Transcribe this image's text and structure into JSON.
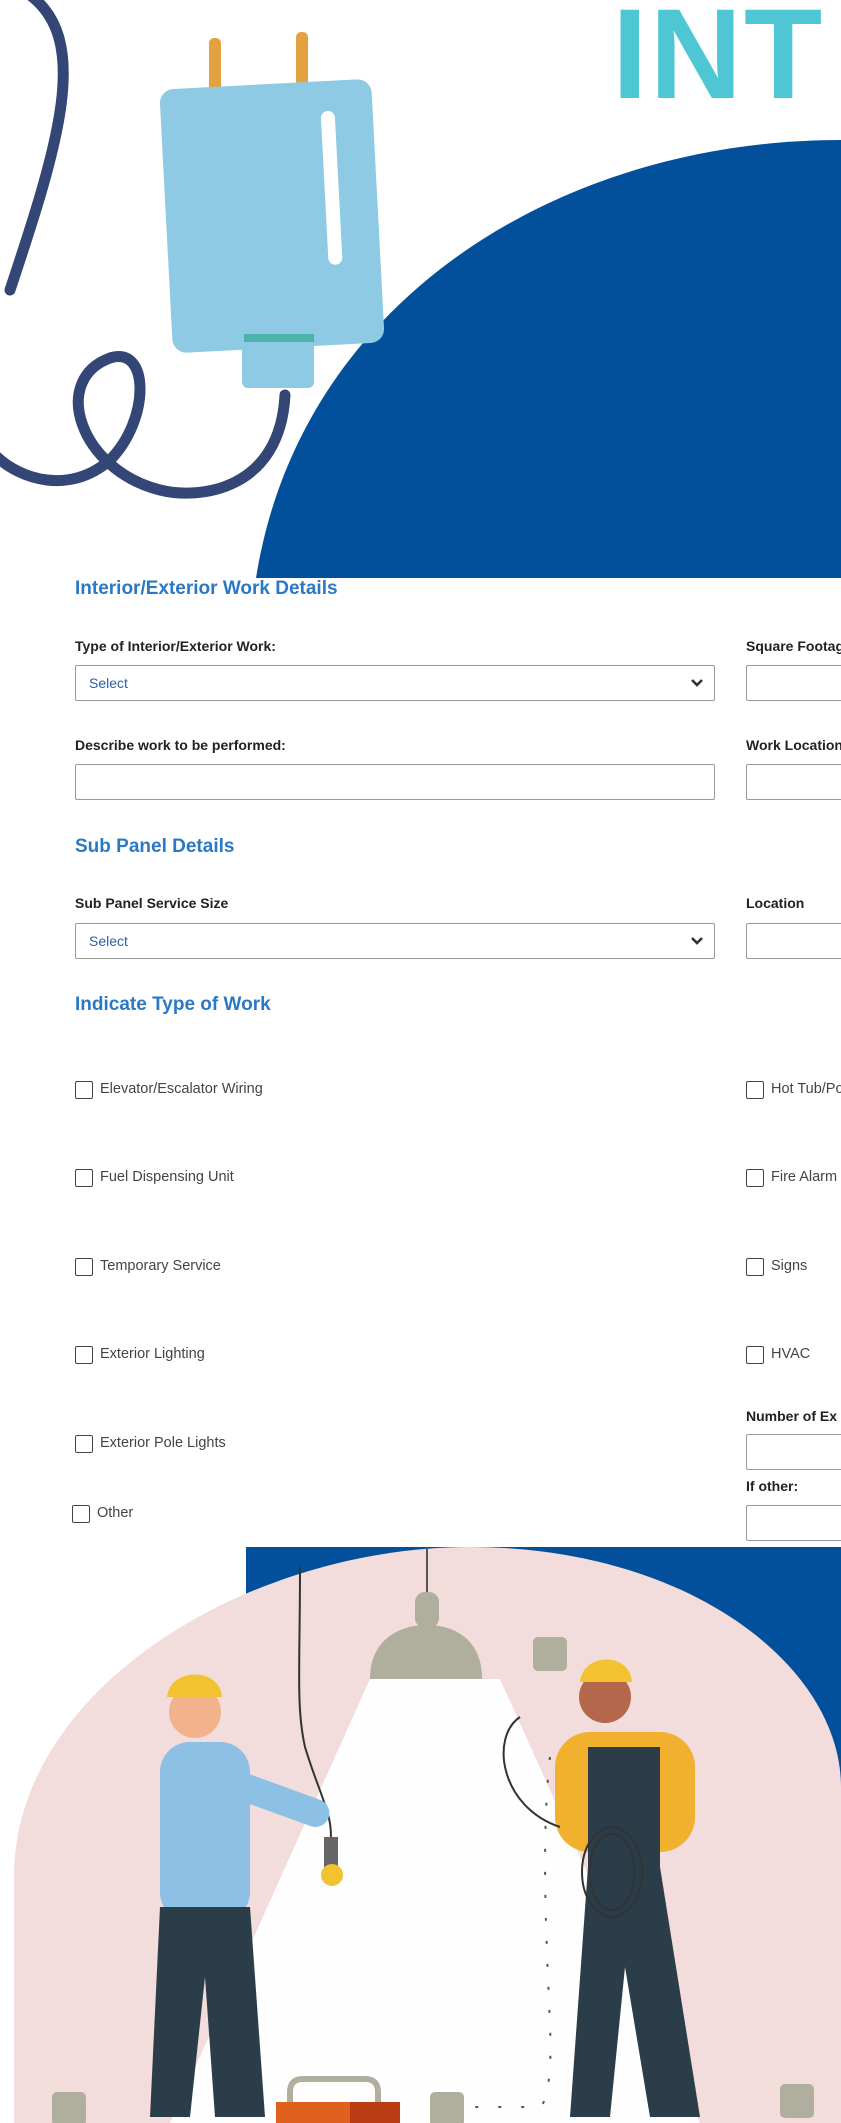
{
  "header": {
    "title": "INT"
  },
  "sections": {
    "work_details": {
      "heading": "Interior/Exterior Work Details",
      "type_label": "Type of Interior/Exterior Work:",
      "type_value": "Select",
      "square_label": "Square Footag",
      "describe_label": "Describe work to be performed:",
      "location_label": "Work Location"
    },
    "sub_panel": {
      "heading": "Sub Panel Details",
      "size_label": "Sub Panel Service Size",
      "size_value": "Select",
      "location_label": "Location"
    },
    "work_type": {
      "heading": "Indicate Type of Work",
      "left_items": [
        "Elevator/Escalator Wiring",
        "Fuel Dispensing Unit",
        "Temporary Service",
        "Exterior Lighting",
        "Exterior Pole Lights"
      ],
      "right_items": [
        "Hot Tub/Po",
        "Fire Alarm",
        "Signs",
        "HVAC"
      ],
      "other_label": "Other",
      "number_label": "Number of Ex",
      "if_other_label": "If other:"
    }
  },
  "colors": {
    "title": "#4fc6d4",
    "heading": "#2b78c5",
    "navy": "#02509b",
    "plug": "#8ecae3",
    "cord": "#344676",
    "pink": "#f2dcdc"
  }
}
